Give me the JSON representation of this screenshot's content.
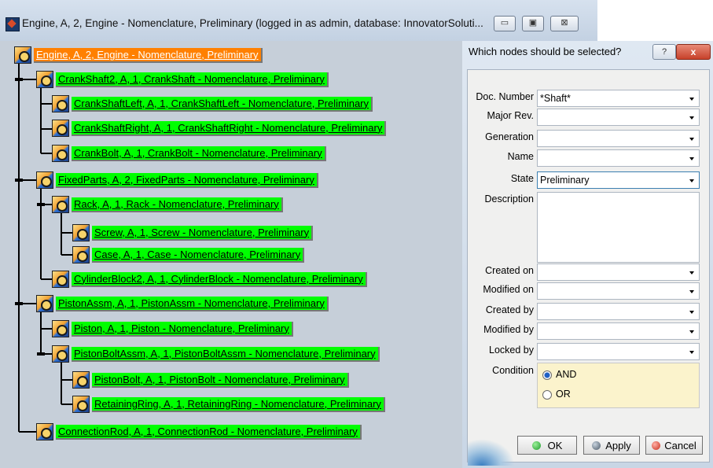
{
  "window": {
    "title": "Engine, A, 2, Engine - Nomenclature, Preliminary (logged in as admin, database: InnovatorSoluti...",
    "minimize_label": "▭",
    "restore_label": "▣",
    "close_label": "⊠"
  },
  "tree": {
    "root": "Engine, A, 2, Engine - Nomenclature, Preliminary",
    "nodes": [
      "CrankShaft2, A, 1, CrankShaft - Nomenclature, Preliminary",
      "CrankShaftLeft, A, 1, CrankShaftLeft - Nomenclature, Preliminary",
      "CrankShaftRight, A, 1, CrankShaftRight - Nomenclature, Preliminary",
      "CrankBolt, A, 1, CrankBolt - Nomenclature, Preliminary",
      "FixedParts, A, 2, FixedParts - Nomenclature, Preliminary",
      "Rack, A, 1, Rack - Nomenclature, Preliminary",
      "Screw, A, 1, Screw - Nomenclature, Preliminary",
      "Case, A, 1, Case - Nomenclature, Preliminary",
      "CylinderBlock2, A, 1, CylinderBlock - Nomenclature, Preliminary",
      "PistonAssm, A, 1, PistonAssm - Nomenclature, Preliminary",
      "Piston, A, 1, Piston - Nomenclature, Preliminary",
      "PistonBoltAssm, A, 1, PistonBoltAssm - Nomenclature, Preliminary",
      "PistonBolt, A, 1, PistonBolt - Nomenclature, Preliminary",
      "RetainingRing, A, 1, RetainingRing - Nomenclature, Preliminary",
      "ConnectionRod, A, 1, ConnectionRod - Nomenclature, Preliminary"
    ],
    "colors": {
      "root_highlight": "#ff8000",
      "selected_highlight": "#00ff00"
    }
  },
  "dialog": {
    "title": "Which nodes should be selected?",
    "help_label": "?",
    "close_label": "x",
    "fields": {
      "doc_number": {
        "label": "Doc. Number",
        "value": "*Shaft*"
      },
      "major_rev": {
        "label": "Major Rev.",
        "value": ""
      },
      "generation": {
        "label": "Generation",
        "value": ""
      },
      "name": {
        "label": "Name",
        "value": ""
      },
      "state": {
        "label": "State",
        "value": "Preliminary"
      },
      "description": {
        "label": "Description",
        "value": ""
      },
      "created_on": {
        "label": "Created on",
        "value": ""
      },
      "modified_on": {
        "label": "Modified on",
        "value": ""
      },
      "created_by": {
        "label": "Created by",
        "value": ""
      },
      "modified_by": {
        "label": "Modified by",
        "value": ""
      },
      "locked_by": {
        "label": "Locked by",
        "value": ""
      }
    },
    "condition": {
      "label": "Condition",
      "options": [
        "AND",
        "OR"
      ],
      "selected": "AND"
    },
    "buttons": {
      "ok": "OK",
      "apply": "Apply",
      "cancel": "Cancel"
    }
  }
}
